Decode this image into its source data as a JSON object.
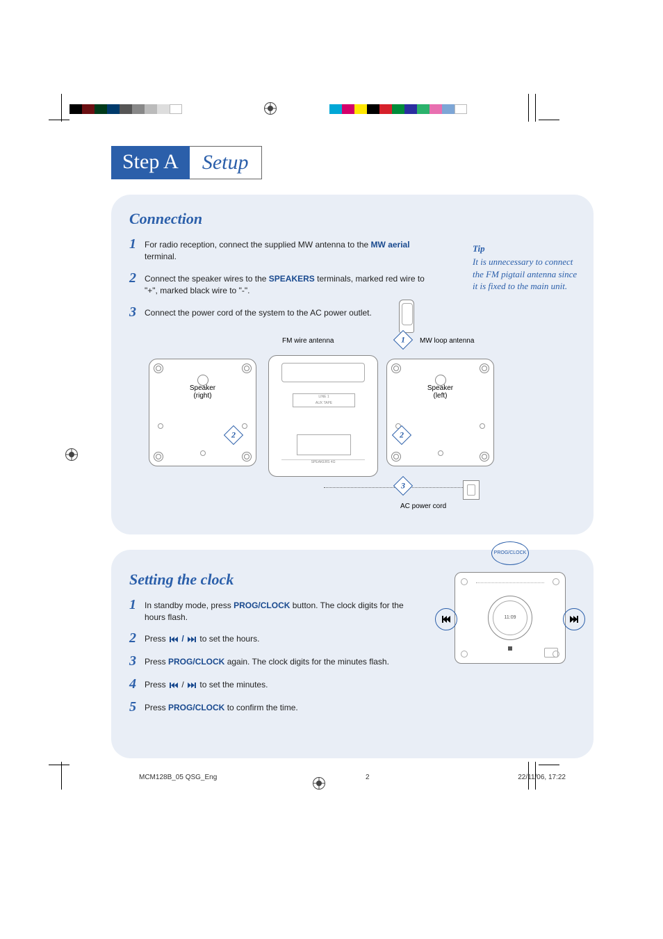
{
  "header": {
    "step_label": "Step A",
    "setup_label": "Setup"
  },
  "connection": {
    "title": "Connection",
    "steps": [
      {
        "num": "1",
        "text_pre": "For radio reception, connect the supplied MW antenna to the ",
        "bold": "MW aerial",
        "text_post": " terminal."
      },
      {
        "num": "2",
        "text_pre": "Connect the speaker wires to the ",
        "bold": "SPEAKERS",
        "text_post": " terminals, marked red wire to \"+\", marked black wire to \"-\"."
      },
      {
        "num": "3",
        "text_pre": "Connect the power cord of the system to the AC power outlet.",
        "bold": "",
        "text_post": ""
      }
    ],
    "tip_title": "Tip",
    "tip_body": "It is unnecessary to connect the FM pigtail antenna since it is fixed to the main unit.",
    "labels": {
      "fm_antenna": "FM wire antenna",
      "mw_antenna": "MW loop antenna",
      "speaker_right": "Speaker\n(right)",
      "speaker_left": "Speaker\n(left)",
      "ac_power": "AC power cord"
    },
    "callouts": {
      "d1": "1",
      "d2": "2",
      "d3": "3"
    }
  },
  "clock": {
    "title": "Setting the clock",
    "steps": {
      "s1": {
        "num": "1",
        "pre": "In standby mode, press ",
        "b": "PROG/CLOCK",
        "post": " button. The clock digits for the hours flash."
      },
      "s2": {
        "num": "2",
        "pre": "Press ",
        "mid": " / ",
        "post": " to set the hours."
      },
      "s3": {
        "num": "3",
        "pre": "Press ",
        "b": "PROG/CLOCK",
        "post": " again. The clock digits for the minutes flash."
      },
      "s4": {
        "num": "4",
        "pre": "Press ",
        "mid": " / ",
        "post": " to set the minutes."
      },
      "s5": {
        "num": "5",
        "pre": "Press ",
        "b": "PROG/CLOCK",
        "post": " to confirm the time."
      }
    },
    "device": {
      "prog_label": "PROG/CLOCK",
      "display": "11:09"
    }
  },
  "footer": {
    "file": "MCM128B_05 QSG_Eng",
    "page": "2",
    "date": "22/11/06, 17:22"
  }
}
